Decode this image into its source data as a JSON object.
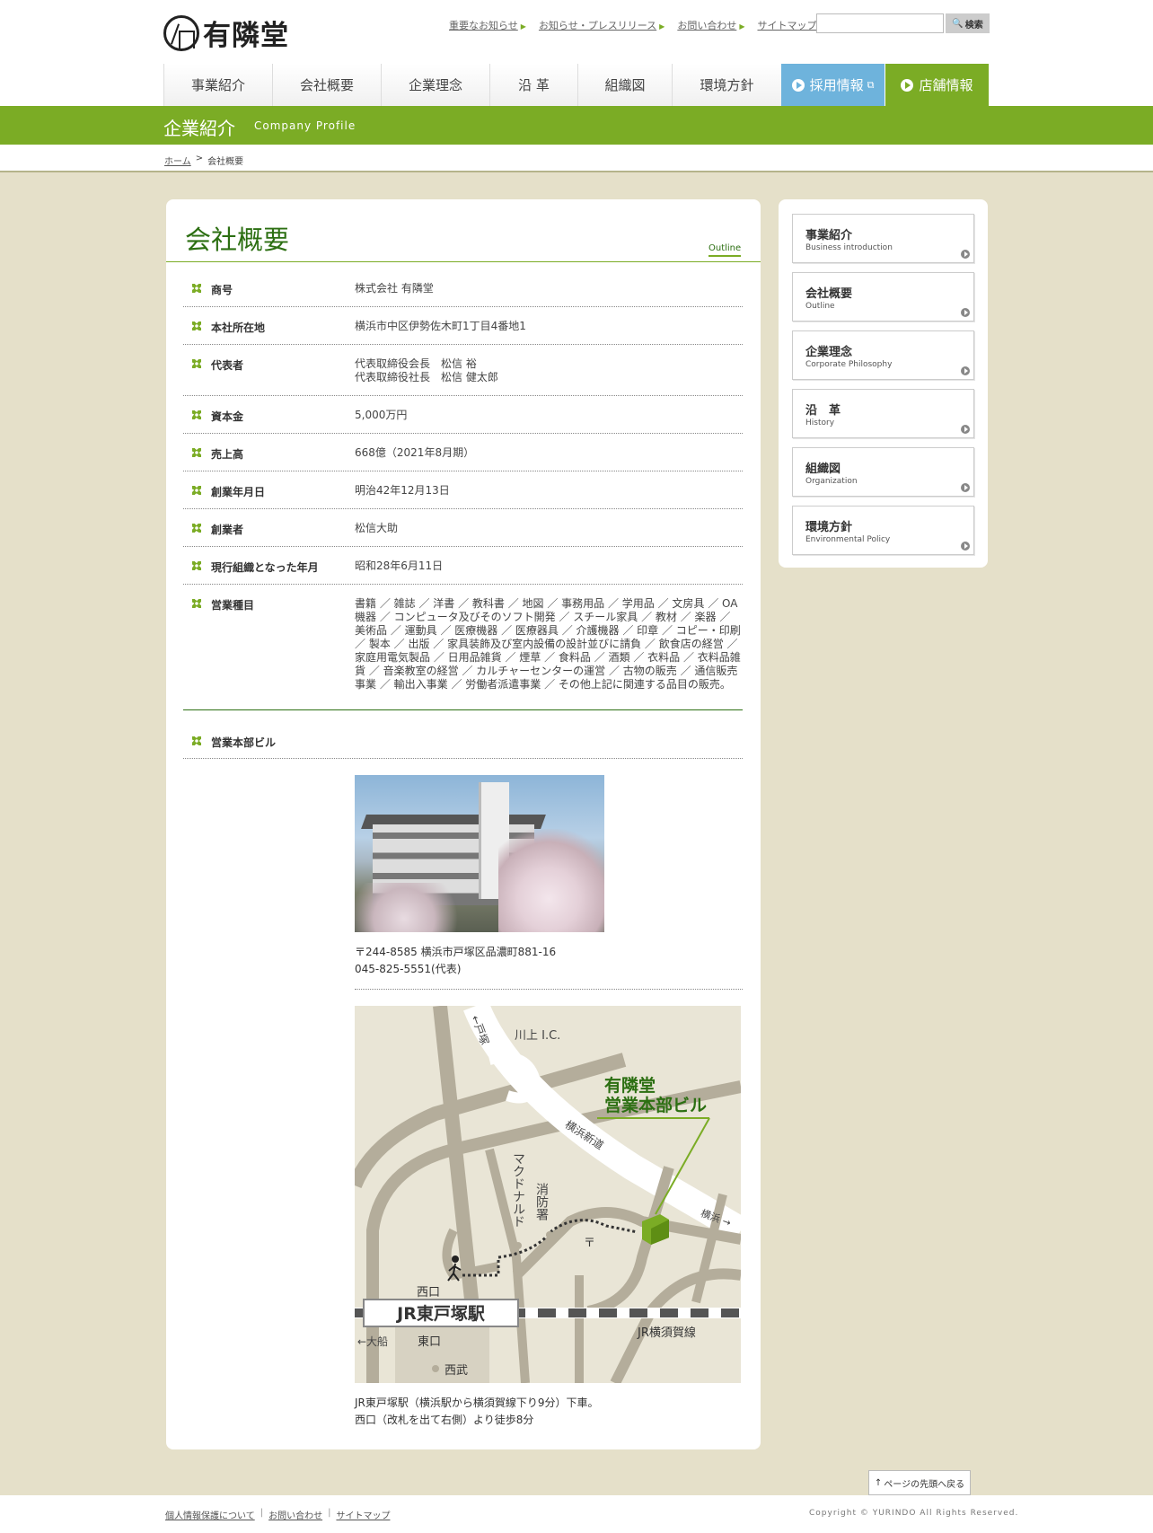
{
  "header": {
    "logo_text": "有隣堂",
    "utility_links": [
      "重要なお知らせ",
      "お知らせ・プレスリリース",
      "お問い合わせ",
      "サイトマップ"
    ],
    "search_placeholder": "",
    "search_button": "検索"
  },
  "gnav": {
    "items": [
      "事業紹介",
      "会社概要",
      "企業理念",
      "沿 革",
      "組織図",
      "環境方針"
    ],
    "recruit": "採用情報",
    "shop": "店舗情報"
  },
  "titlebar": {
    "jp": "企業紹介",
    "en": "Company Profile"
  },
  "breadcrumb": {
    "home": "ホーム",
    "sep": ">",
    "current": "会社概要"
  },
  "main": {
    "title": "会社概要",
    "outline_label": "Outline",
    "rows": [
      {
        "label": "商号",
        "value": "株式会社 有隣堂"
      },
      {
        "label": "本社所在地",
        "value": "横浜市中区伊勢佐木町1丁目4番地1"
      },
      {
        "label": "代表者",
        "value": "代表取締役会長　松信 裕",
        "value2": "代表取締役社長　松信 健太郎"
      },
      {
        "label": "資本金",
        "value": "5,000万円"
      },
      {
        "label": "売上高",
        "value": "668億（2021年8月期）"
      },
      {
        "label": "創業年月日",
        "value": "明治42年12月13日"
      },
      {
        "label": "創業者",
        "value": "松信大助"
      },
      {
        "label": "現行組織となった年月",
        "value": "昭和28年6月11日"
      },
      {
        "label": "営業種目",
        "value": "書籍 ／ 雑誌 ／ 洋書 ／ 教科書 ／ 地図 ／ 事務用品 ／ 学用品 ／ 文房具 ／ OA機器 ／ コンピュータ及びそのソフト開発 ／ スチール家具 ／ 教材 ／ 楽器 ／ 美術品 ／ 運動具 ／ 医療機器 ／ 医療器具 ／ 介護機器 ／ 印章 ／ コピー・印刷 ／ 製本 ／ 出版 ／ 家具装飾及び室内設備の設計並びに請負 ／ 飲食店の経営 ／ 家庭用電気製品 ／ 日用品雑貨 ／ 煙草 ／ 食料品 ／ 酒類 ／ 衣料品 ／ 衣料品雑貨 ／ 音楽教室の経営 ／ カルチャーセンターの運営 ／ 古物の販売 ／ 通信販売事業 ／ 輸出入事業 ／ 労働者派遣事業 ／ その他上記に関連する品目の販売。"
      },
      {
        "label": "営業本部ビル",
        "value": ""
      }
    ],
    "address_line1": "〒244-8585 横浜市戸塚区品濃町881-16",
    "address_line2": "045-825-5551(代表)",
    "map": {
      "building_line1": "有隣堂",
      "building_line2": "営業本部ビル",
      "totsuka": "←戸塚",
      "kawakami": "川上 I.C.",
      "yokohama_shindo": "横浜新道",
      "mcdonald": "マクドナルド",
      "fire_station": "消防署",
      "yokohama": "横浜 →",
      "west_exit": "西口",
      "station": "JR東戸塚駅",
      "east_exit": "東口",
      "ofuna": "←大船",
      "seibu": "西武",
      "jr_line": "JR横須賀線",
      "post": "〒"
    },
    "access_line1": "JR東戸塚駅（横浜駅から横須賀線下り9分）下車。",
    "access_line2": "西口（改札を出て右側）より徒歩8分"
  },
  "sidebar": {
    "items": [
      {
        "jp": "事業紹介",
        "en": "Business introduction"
      },
      {
        "jp": "会社概要",
        "en": "Outline"
      },
      {
        "jp": "企業理念",
        "en": "Corporate Philosophy"
      },
      {
        "jp": "沿　革",
        "en": "History"
      },
      {
        "jp": "組織図",
        "en": "Organization"
      },
      {
        "jp": "環境方針",
        "en": "Environmental Policy"
      }
    ]
  },
  "pagetop": "ページの先頭へ戻る",
  "footer": {
    "links": [
      "個人情報保護について",
      "お問い合わせ",
      "サイトマップ"
    ],
    "copyright": "Copyright © YURINDO All Rights Reserved."
  },
  "colors": {
    "accent_green": "#7bac25",
    "dark_green": "#2c6f12",
    "recruit_blue": "#6eb3dc",
    "page_bg": "#e5e0c9"
  }
}
